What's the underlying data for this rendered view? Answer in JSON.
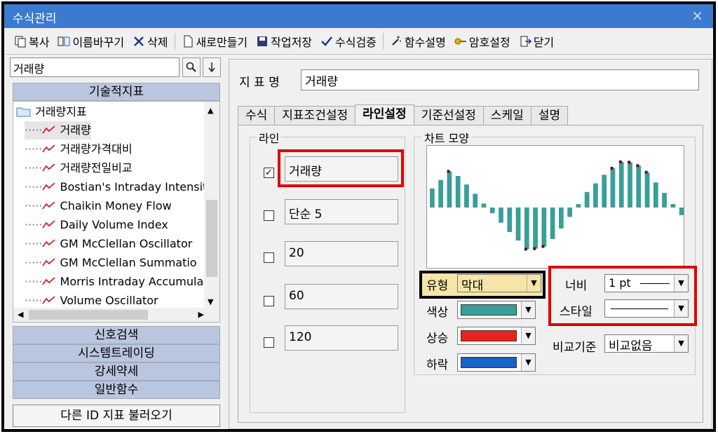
{
  "window": {
    "title": "수식관리",
    "close_symbol": "×"
  },
  "toolbar": {
    "copy": "복사",
    "rename": "이름바꾸기",
    "delete": "삭제",
    "new": "새로만들기",
    "save": "작업저장",
    "verify": "수식검증",
    "func_help": "함수설명",
    "password": "암호설정",
    "close": "닫기"
  },
  "left": {
    "search_value": "거래량",
    "category_top": "기술적지표",
    "folder": "거래량지표",
    "items": [
      "거래량",
      "거래량가격대비",
      "거래량전일비교",
      "Bostian's Intraday Intensit",
      "Chaikin Money Flow",
      "Daily Volume Index",
      "GM McClellan Oscillator",
      "GM McClellan Summatio",
      "Morris Intraday Accumula",
      "Volume Oscillator"
    ],
    "categories": [
      "신호검색",
      "시스템트레이딩",
      "강세약세",
      "일반함수"
    ],
    "load_button": "다른 ID 지표 불러오기"
  },
  "right": {
    "name_label": "지 표 명",
    "name_value": "거래량",
    "tabs": [
      "수식",
      "지표조건설정",
      "라인설정",
      "기준선설정",
      "스케일",
      "설명"
    ],
    "line_group": "라인",
    "lines": [
      {
        "checked": "✓",
        "value": "거래량"
      },
      {
        "checked": "",
        "value": "단순 5"
      },
      {
        "checked": "",
        "value": "20"
      },
      {
        "checked": "",
        "value": "60"
      },
      {
        "checked": "",
        "value": "120"
      }
    ],
    "chart_group": "차트 모양",
    "type_label": "유형",
    "type_value": "막대",
    "color_label": "색상",
    "color_value": "#3a9e98",
    "up_label": "상승",
    "up_color": "#e8231a",
    "down_label": "하락",
    "down_color": "#1a63c8",
    "width_label": "너비",
    "width_value": "1 pt",
    "style_label": "스타일",
    "compare_label": "비교기준",
    "compare_value": "비교없음"
  },
  "chart_data": {
    "type": "bar",
    "values": [
      20,
      40,
      20,
      -3,
      -25,
      -45,
      -40,
      -15,
      15,
      35,
      50,
      42,
      18,
      -8
    ]
  }
}
